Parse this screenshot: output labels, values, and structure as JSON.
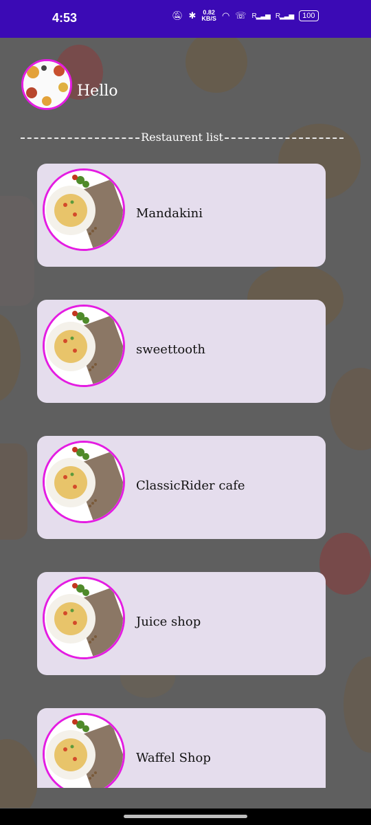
{
  "status_bar": {
    "time": "4:53",
    "speed_value": "0.82",
    "speed_unit": "KB/S",
    "battery": "100",
    "icons": [
      "mute-icon",
      "bluetooth-icon",
      "wifi-icon",
      "volte-icon",
      "signal-icon",
      "signal-icon",
      "battery-icon"
    ]
  },
  "header": {
    "greeting": "Hello",
    "list_title": "Restaurent list"
  },
  "restaurants": [
    {
      "name": "Mandakini"
    },
    {
      "name": "sweettooth"
    },
    {
      "name": "ClassicRider cafe"
    },
    {
      "name": "Juice shop"
    },
    {
      "name": "Waffel Shop"
    }
  ],
  "colors": {
    "status_bar": "#3b0ab5",
    "accent_border": "#e41ce2",
    "card_bg": "#e5dded",
    "background": "#5f5f5f"
  }
}
